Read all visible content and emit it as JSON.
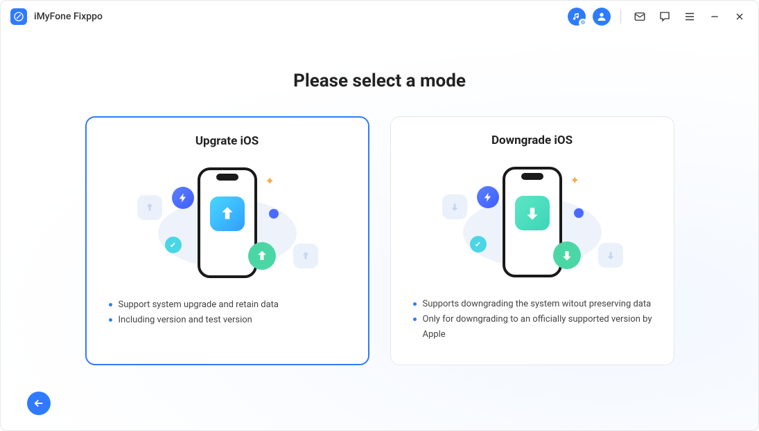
{
  "app": {
    "title": "iMyFone Fixppo"
  },
  "page": {
    "title": "Please select a mode"
  },
  "cards": {
    "upgrade": {
      "title": "Upgrate iOS",
      "bullets": [
        "Support system upgrade and retain data",
        "Including version and test version"
      ]
    },
    "downgrade": {
      "title": "Downgrade iOS",
      "bullets": [
        "Supports downgrading the system witout preserving data",
        "Only for downgrading to an officially supported version by Apple"
      ]
    }
  },
  "colors": {
    "accent": "#2f7bff"
  }
}
